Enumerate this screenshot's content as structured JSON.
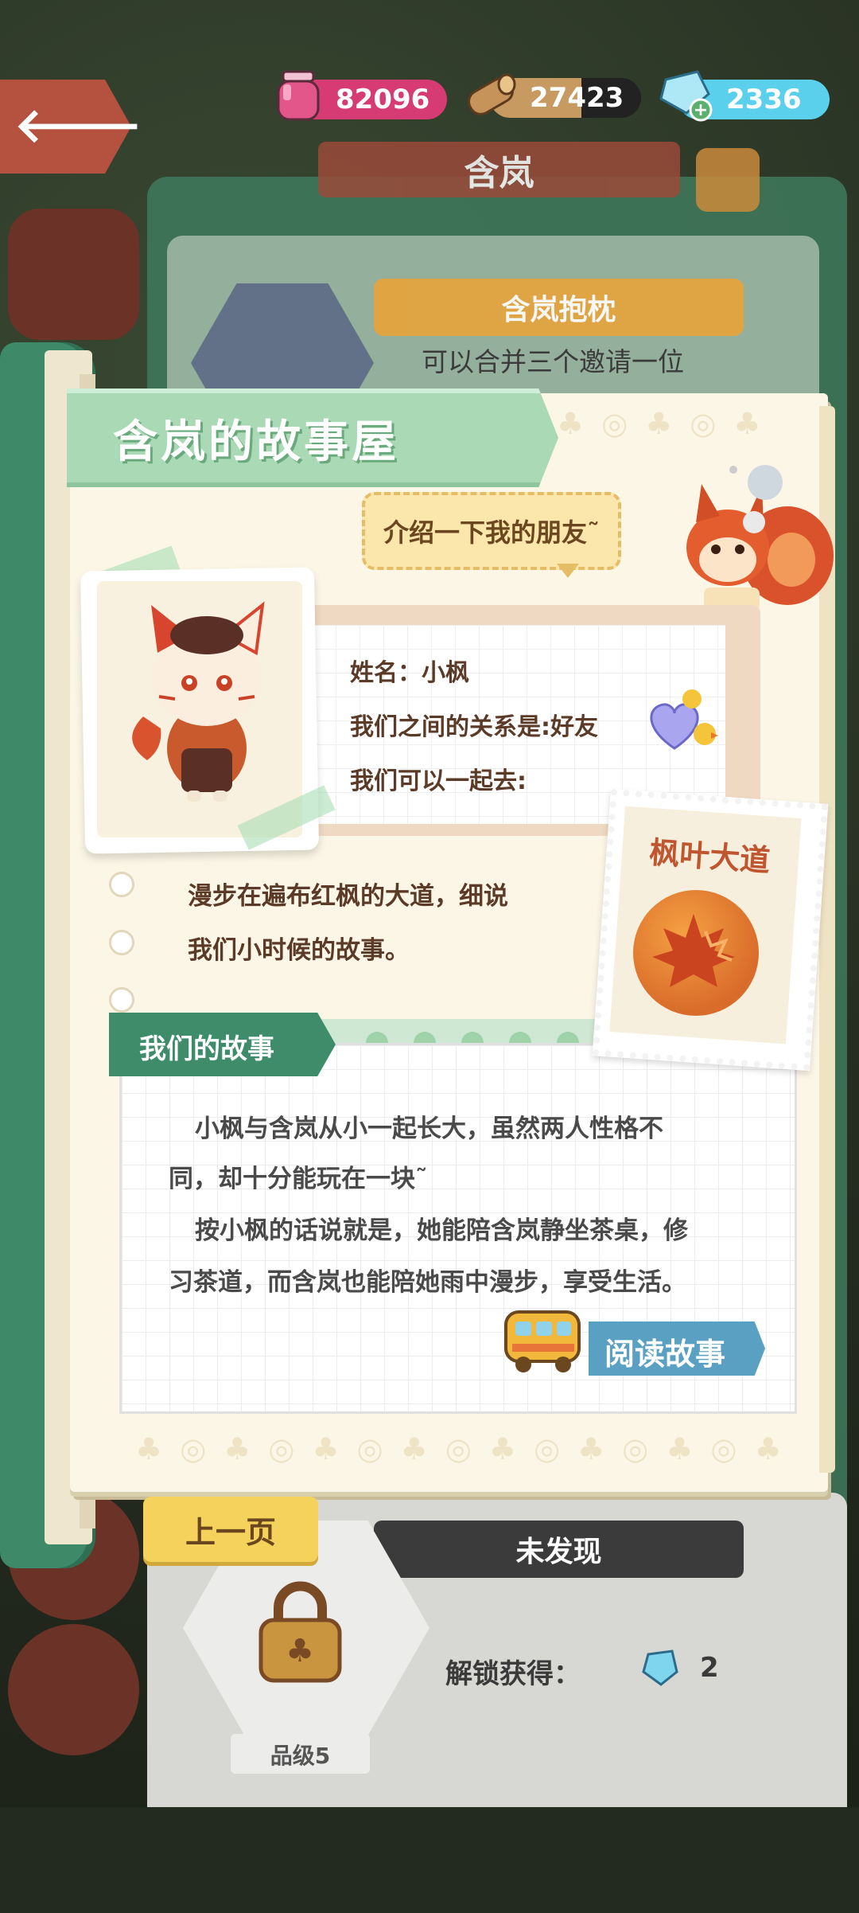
{
  "currency": {
    "ink": "82096",
    "wood": "27423",
    "gems": "2336"
  },
  "background": {
    "character_name": "含岚",
    "card_title": "含岚抱枕",
    "card_text": "可以合并三个邀请一位",
    "undiscovered_label": "未发现",
    "unlock_label": "解锁获得：",
    "unlock_count": "2",
    "grade_label": "品级5"
  },
  "story_page": {
    "title": "含岚的故事屋",
    "speech": "介绍一下我的朋友˜",
    "profile": {
      "name_line": "姓名：小枫",
      "relation_line": "我们之间的关系是:好友",
      "together_line": "我们可以一起去:"
    },
    "location": "枫叶大道",
    "description": [
      "漫步在遍布红枫的大道，细说",
      "我们小时候的故事。"
    ],
    "story_tab": "我们的故事",
    "story_lines": [
      "小枫与含岚从小一起长大，虽然两人性格不",
      "同，却十分能玩在一块˜",
      "按小枫的话说就是，她能陪含岚静坐茶桌，修",
      "习茶道，而含岚也能陪她雨中漫步，享受生活。"
    ],
    "read_button": "阅读故事",
    "prev_button": "上一页"
  },
  "colors": {
    "book_green": "#3e8a68",
    "banner_green": "#a9d9b5",
    "ink_pink": "#d63b73",
    "gem_blue": "#5bd0ec",
    "read_button_blue": "#5aa0c2",
    "prev_button_yellow": "#f5d25b"
  }
}
